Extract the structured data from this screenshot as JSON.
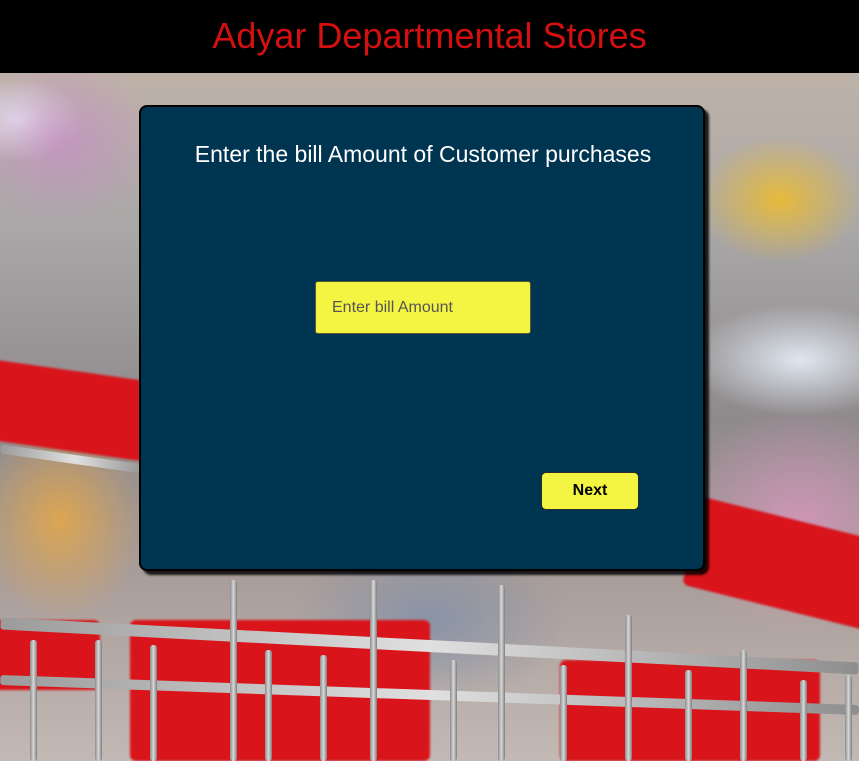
{
  "header": {
    "title": "Adyar Departmental Stores"
  },
  "form": {
    "heading": "Enter the bill Amount of Customer purchases",
    "bill_input": {
      "placeholder": "Enter bill Amount",
      "value": ""
    },
    "next_label": "Next"
  },
  "colors": {
    "header_bg": "#000000",
    "header_text": "#d40f0f",
    "card_bg": "#003552",
    "accent_yellow": "#f4f442",
    "card_text": "#ffffff"
  },
  "background": {
    "image": "shopping-cart-photo"
  }
}
